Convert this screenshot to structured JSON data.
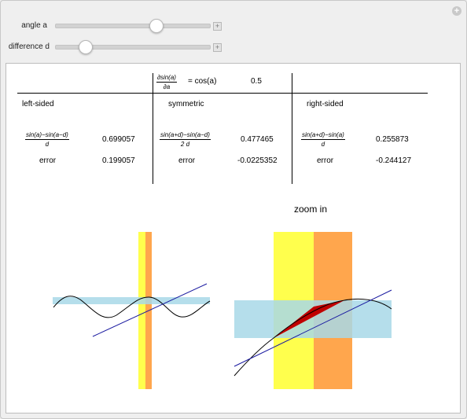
{
  "controls": {
    "angle_label": "angle a",
    "difference_label": "difference d",
    "angle_value": 0.5,
    "difference_value": 0.2
  },
  "table": {
    "header_deriv_num": "∂sin(a)",
    "header_deriv_den": "∂a",
    "header_eq": "= cos(a)",
    "header_value": "0.5",
    "left_title": "left-sided",
    "sym_title": "symmetric",
    "right_title": "right-sided",
    "left_num": "sin(a)−sin(a−d)",
    "left_den": "d",
    "left_value": "0.699057",
    "left_error_label": "error",
    "left_error": "0.199057",
    "sym_num": "sin(a+d)−sin(a−d)",
    "sym_den": "2 d",
    "sym_value": "0.477465",
    "sym_error_label": "error",
    "sym_error": "-0.0225352",
    "right_num": "sin(a+d)−sin(a)",
    "right_den": "d",
    "right_value": "0.255873",
    "right_error_label": "error",
    "right_error": "-0.244127"
  },
  "plot": {
    "zoom_title": "zoom in",
    "colors": {
      "yellow": "#ffff4d",
      "orange": "#ffa64d",
      "light_blue": "#a8d8e8",
      "tangent": "#1a1aa0",
      "secant_fill": "#c00000",
      "curve": "#000000"
    }
  }
}
